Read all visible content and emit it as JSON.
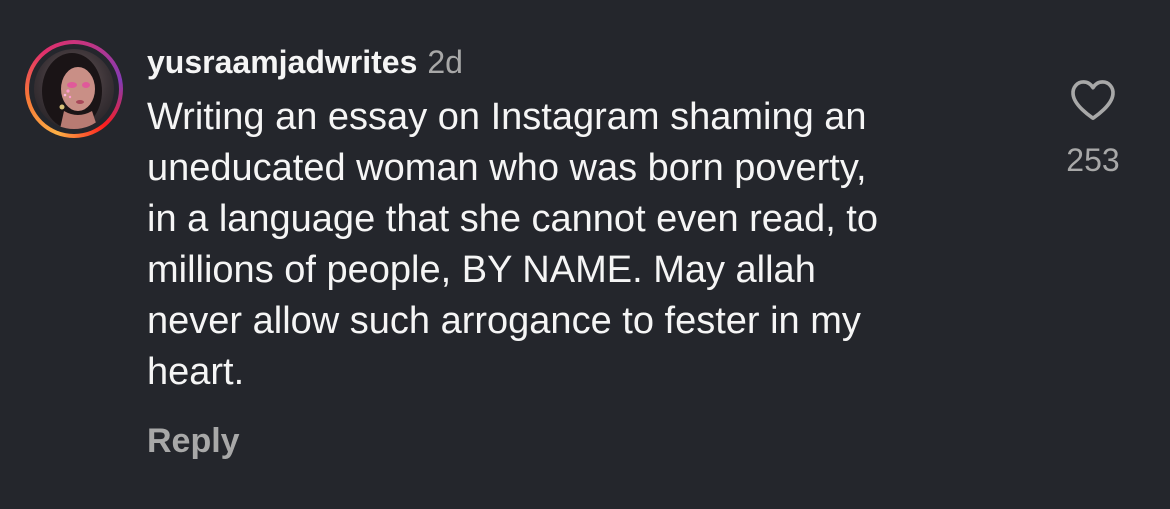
{
  "comment": {
    "username": "yusraamjadwrites",
    "timestamp": "2d",
    "lines": [
      "Writing an essay on Instagram shaming an",
      "uneducated woman who was born poverty,",
      "in a language that she cannot even read, to",
      "millions of people, BY NAME. May allah",
      "never allow such arrogance to fester in my",
      "heart."
    ],
    "reply_label": "Reply",
    "like_count": "253"
  },
  "icons": {
    "like": "heart-outline-icon",
    "avatar": "profile-photo"
  },
  "colors": {
    "background": "#24262c",
    "text_primary": "#f5f5f5",
    "text_secondary": "#a8a8a8"
  }
}
